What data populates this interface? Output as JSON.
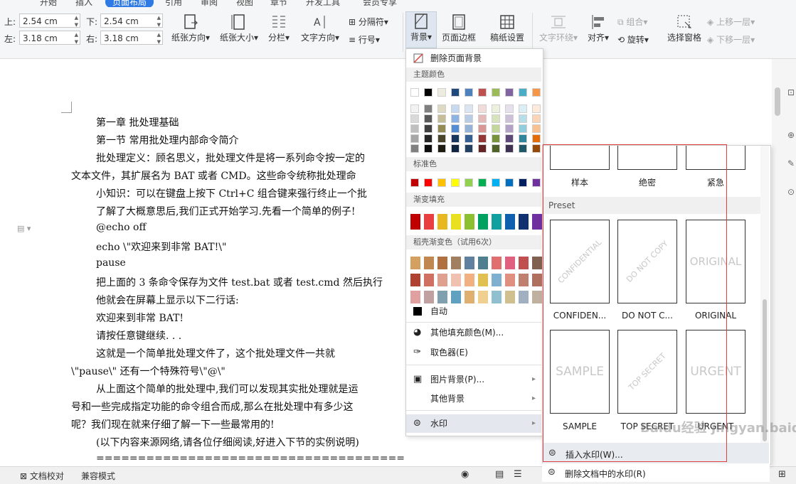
{
  "ribbon": {
    "tabs": [
      "开始",
      "插入",
      "页面布局",
      "引用",
      "审阅",
      "视图",
      "章节",
      "开发工具",
      "会员专享"
    ],
    "margins": {
      "top_label": "上:",
      "top_value": "2.54 cm",
      "bottom_label": "下:",
      "bottom_value": "2.54 cm",
      "left_label": "左:",
      "left_value": "3.18 cm",
      "right_label": "右:",
      "right_value": "3.18 cm"
    },
    "buttons": {
      "orientation": "纸张方向",
      "size": "纸张大小",
      "columns": "分栏",
      "text_direction": "文字方向",
      "breaks": "分隔符",
      "line_numbers": "行号",
      "background": "背景",
      "page_border": "页面边框",
      "manuscript": "稿纸设置",
      "text_wrap": "文字环绕",
      "align": "对齐",
      "group": "组合",
      "rotate": "旋转",
      "selection_pane": "选择窗格",
      "bring_forward": "上移一层",
      "send_backward": "下移一层"
    }
  },
  "document": {
    "lines": [
      "第一章  批处理基础",
      "第一节  常用批处理内部命令简介",
      "批处理定义：顾名思义，批处理文件是将一系列命令按一定的",
      "文本文件，其扩展名为 BAT 或者 CMD。这些命令统称批处理命",
      "小知识：可以在键盘上按下 Ctrl+C 组合键来强行终止一个批",
      "了解了大概意思后,我们正式开始学习.先看一个简单的例子!",
      "@echo off",
      "echo \\\"欢迎来到非常 BAT!\\\"",
      "pause",
      "把上面的 3 条命令保存为文件 test.bat 或者 test.cmd 然后执行",
      "他就会在屏幕上显示以下二行话:",
      "欢迎来到非常 BAT!",
      "请按任意键继续. . .",
      "这就是一个简单批处理文件了，这个批处理文件一共就",
      "\\\"pause\\\"  还有一个特殊符号\\\"@\\\"",
      "从上面这个简单的批处理中,我们可以发现其实批处理就是运",
      "号和一些完成指定功能的命令组合而成,那么在批处理中有多少这",
      "呢？我们现在就来仔细了解一下一些最常用的!",
      "(以下内容来源网络,请各位仔细阅读,好进入下节的实例说明)",
      "========================================"
    ]
  },
  "menu": {
    "remove_bg": "删除页面背景",
    "theme_colors": "主题颜色",
    "standard_colors": "标准色",
    "gradient_fill": "渐变填充",
    "docer_gradient": "稻壳渐变色（试用6次）",
    "auto": "自动",
    "more_fill": "其他填充颜色(M)...",
    "eyedropper": "取色器(E)",
    "picture_bg": "图片背景(P)...",
    "other_bg": "其他背景",
    "watermark": "水印"
  },
  "colors": {
    "theme_top": [
      "#ffffff",
      "#000000",
      "#eeece1",
      "#1f497d",
      "#4f81bd",
      "#c0504d",
      "#9bbb59",
      "#8064a2",
      "#4bacc6",
      "#f79646"
    ],
    "theme_cols": [
      [
        "#f2f2f2",
        "#d9d9d9",
        "#bfbfbf",
        "#a6a6a6",
        "#808080"
      ],
      [
        "#7f7f7f",
        "#595959",
        "#404040",
        "#262626",
        "#0d0d0d"
      ],
      [
        "#ddd9c3",
        "#c4bd97",
        "#948a54",
        "#4a452a",
        "#1e1c11"
      ],
      [
        "#c6d9f0",
        "#8db3e2",
        "#548dd4",
        "#17365d",
        "#0f243e"
      ],
      [
        "#dbe5f1",
        "#b8cce4",
        "#95b3d7",
        "#366092",
        "#244061"
      ],
      [
        "#f2dcdb",
        "#e5b9b7",
        "#d99694",
        "#953734",
        "#632423"
      ],
      [
        "#ebf1dd",
        "#d7e3bc",
        "#c3d69b",
        "#76923c",
        "#4f6128"
      ],
      [
        "#e5e0ec",
        "#ccc1d9",
        "#b2a2c7",
        "#5f497a",
        "#3f3151"
      ],
      [
        "#dbeef3",
        "#b7dde8",
        "#92cddc",
        "#31859b",
        "#205867"
      ],
      [
        "#fdeada",
        "#fbd5b5",
        "#fac08f",
        "#e36c09",
        "#974806"
      ]
    ],
    "standard": [
      "#c00000",
      "#ff0000",
      "#ffc000",
      "#ffff00",
      "#92d050",
      "#00b050",
      "#00b0f0",
      "#0070c0",
      "#002060",
      "#7030a0"
    ],
    "gradient": [
      "#c00000",
      "#e84040",
      "#e8b820",
      "#e8e020",
      "#8cc030",
      "#00a060",
      "#10a0a0",
      "#1060b0",
      "#103070",
      "#7030a0"
    ],
    "docer_rows": [
      [
        "#d4a060",
        "#c08850",
        "#b07040",
        "#a08060",
        "#6080a0",
        "#508090",
        "#e07070",
        "#e06080",
        "#c05050",
        "#806050"
      ],
      [
        "#b04030",
        "#d07060",
        "#e0a090",
        "#f0c0b0",
        "#f0b080",
        "#e0c050",
        "#80b0d0",
        "#e09080",
        "#c08070",
        "#b07060"
      ],
      [
        "#e0a0a0",
        "#c0a0a0",
        "#80a0b0",
        "#60a0c0",
        "#e0b070",
        "#f0d090",
        "#90c0d0",
        "#d0c090",
        "#a0b0c0",
        "#c0b0a0"
      ]
    ],
    "accent": "#2f7be5",
    "highlight_red": "#e04040"
  },
  "submenu": {
    "custom_labels": [
      "样本",
      "绝密",
      "紧急"
    ],
    "preset_header": "Preset",
    "presets": [
      {
        "label": "CONFIDEN...",
        "text": "CONFIDENTIAL",
        "style": "diagonal"
      },
      {
        "label": "DO NOT C...",
        "text": "DO NOT COPY",
        "style": "diagonal"
      },
      {
        "label": "ORIGINAL",
        "text": "ORIGINAL",
        "style": "flat"
      },
      {
        "label": "SAMPLE",
        "text": "SAMPLE",
        "style": "flat"
      },
      {
        "label": "TOP SECRET",
        "text": "TOP SECRET",
        "style": "diagonal"
      },
      {
        "label": "URGENT",
        "text": "URGENT",
        "style": "flat"
      }
    ],
    "insert_watermark": "插入水印(W)...",
    "remove_watermark": "删除文档中的水印(R)"
  },
  "status": {
    "proofread": "文档校对",
    "compat": "兼容模式"
  },
  "watermark_overlay": "Baidu经验 jingyan.baidu.com"
}
